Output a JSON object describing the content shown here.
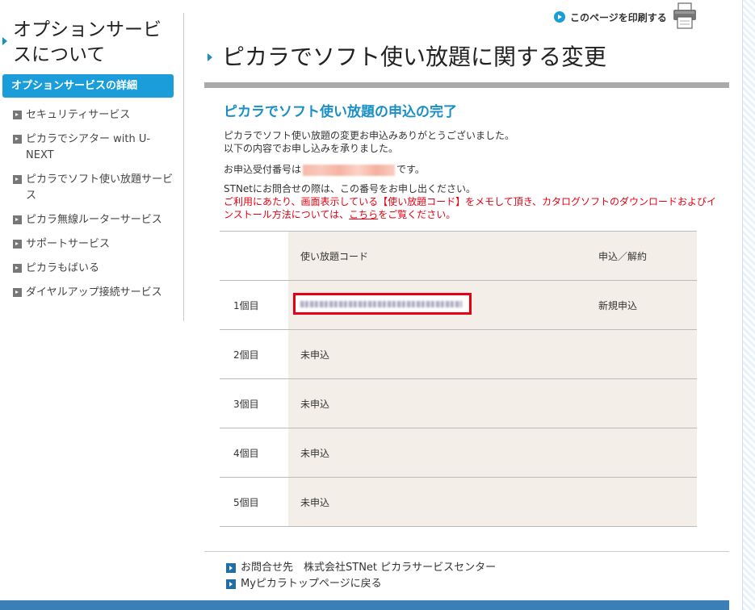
{
  "sidebar": {
    "title": "オプションサービスについて",
    "active_label": "オプションサービスの詳細",
    "items": [
      {
        "label": "セキュリティサービス"
      },
      {
        "label": "ピカラでシアター with U-NEXT"
      },
      {
        "label": "ピカラでソフト使い放題サービス"
      },
      {
        "label": "ピカラ無線ルーターサービス"
      },
      {
        "label": "サポートサービス"
      },
      {
        "label": "ピカラもばいる"
      },
      {
        "label": "ダイヤルアップ接続サービス"
      }
    ]
  },
  "header": {
    "print_label": "このページを印刷する",
    "page_title": "ピカラでソフト使い放題に関する変更"
  },
  "main": {
    "sub_title": "ピカラでソフト使い放題の申込の完了",
    "line1": "ピカラでソフト使い放題の変更お申込みありがとうございました。",
    "line2": "以下の内容でお申し込みを承りました。",
    "receipt_prefix": "お申込受付番号は",
    "receipt_suffix": "です。",
    "line4": "STNetにお問合せの際は、この番号をお申し出ください。",
    "red_text_1": "ご利用にあたり、画面表示している【使い放題コード】をメモして頂き、カタログソフトのダウンロードおよびインストール方法については、",
    "red_link": "こちら",
    "red_text_2": "をご覧ください。"
  },
  "table": {
    "headers": [
      "",
      "使い放題コード",
      "申込／解約"
    ],
    "rows": [
      {
        "index": "1個目",
        "code": "",
        "status": "新規申込"
      },
      {
        "index": "2個目",
        "code": "未申込",
        "status": ""
      },
      {
        "index": "3個目",
        "code": "未申込",
        "status": ""
      },
      {
        "index": "4個目",
        "code": "未申込",
        "status": ""
      },
      {
        "index": "5個目",
        "code": "未申込",
        "status": ""
      }
    ]
  },
  "footer": {
    "contact": "お問合せ先　株式会社STNet ピカラサービスセンター",
    "top_link": "Myピカラトップページに戻る"
  },
  "colors": {
    "accent": "#1a9dd9",
    "warning": "#e60012",
    "bottom_bar": "#3a7fb5"
  }
}
